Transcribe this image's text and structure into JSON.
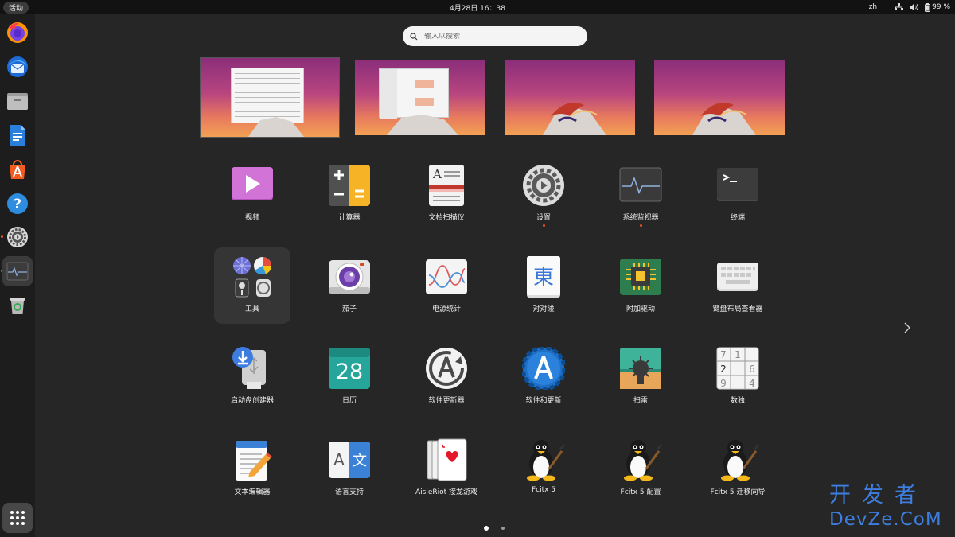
{
  "topbar": {
    "activities": "活动",
    "clock": "4月28日 16：38",
    "language": "zh",
    "battery": "99 %"
  },
  "dock": {
    "items": [
      "firefox-icon",
      "thunderbird-icon",
      "files-icon",
      "writer-icon",
      "app-center-icon",
      "help-icon",
      "settings-icon",
      "system-monitor-icon",
      "trash-icon"
    ],
    "show_apps": "show-apps-icon"
  },
  "search": {
    "placeholder": "输入以搜索"
  },
  "apps": [
    {
      "label": "视频",
      "icon": "videos-icon",
      "running": false
    },
    {
      "label": "计算器",
      "icon": "calculator-icon",
      "running": false
    },
    {
      "label": "文档扫描仪",
      "icon": "scanner-icon",
      "running": false
    },
    {
      "label": "设置",
      "icon": "settings-icon",
      "running": true
    },
    {
      "label": "系统监视器",
      "icon": "system-monitor-icon",
      "running": true
    },
    {
      "label": "终端",
      "icon": "terminal-icon",
      "running": false
    },
    {
      "label": "工具",
      "icon": "folder-icon",
      "running": false,
      "folder": true
    },
    {
      "label": "茄子",
      "icon": "cheese-icon",
      "running": false
    },
    {
      "label": "电源统计",
      "icon": "power-statistics-icon",
      "running": false
    },
    {
      "label": "对对碰",
      "icon": "mahjongg-icon",
      "glyph": "東",
      "running": false
    },
    {
      "label": "附加驱动",
      "icon": "chip-icon",
      "running": false
    },
    {
      "label": "键盘布局查看器",
      "icon": "keyboard-icon",
      "running": false
    },
    {
      "label": "启动盘创建器",
      "icon": "usb-creator-icon",
      "running": false
    },
    {
      "label": "日历",
      "icon": "calendar-icon",
      "number": "28",
      "running": false
    },
    {
      "label": "软件更新器",
      "icon": "software-updater-icon",
      "running": false
    },
    {
      "label": "软件和更新",
      "icon": "software-properties-icon",
      "running": false
    },
    {
      "label": "扫雷",
      "icon": "mines-icon",
      "running": false
    },
    {
      "label": "数独",
      "icon": "sudoku-icon",
      "running": false
    },
    {
      "label": "文本编辑器",
      "icon": "text-editor-icon",
      "running": false
    },
    {
      "label": "语言支持",
      "icon": "language-support-icon",
      "glyph_a": "A",
      "glyph_b": "文",
      "running": false
    },
    {
      "label": "AisleRiot 接龙游戏",
      "icon": "aisleriot-icon",
      "running": false
    },
    {
      "label": "Fcitx 5",
      "icon": "tux-icon",
      "running": false
    },
    {
      "label": "Fcitx 5 配置",
      "icon": "tux-icon",
      "running": false
    },
    {
      "label": "Fcitx 5 迁移向导",
      "icon": "tux-icon",
      "running": false
    }
  ],
  "sudoku_digits": [
    "7",
    "1",
    "2",
    "6",
    "9",
    "4"
  ],
  "pager": {
    "pages": 2,
    "current": 1
  },
  "watermark": {
    "line1": "开发者",
    "line2": "DevZe.CoM"
  },
  "colors": {
    "accent": "#e95420",
    "panel": "#121212",
    "background": "#262626",
    "dock": "#1d1d1d"
  }
}
